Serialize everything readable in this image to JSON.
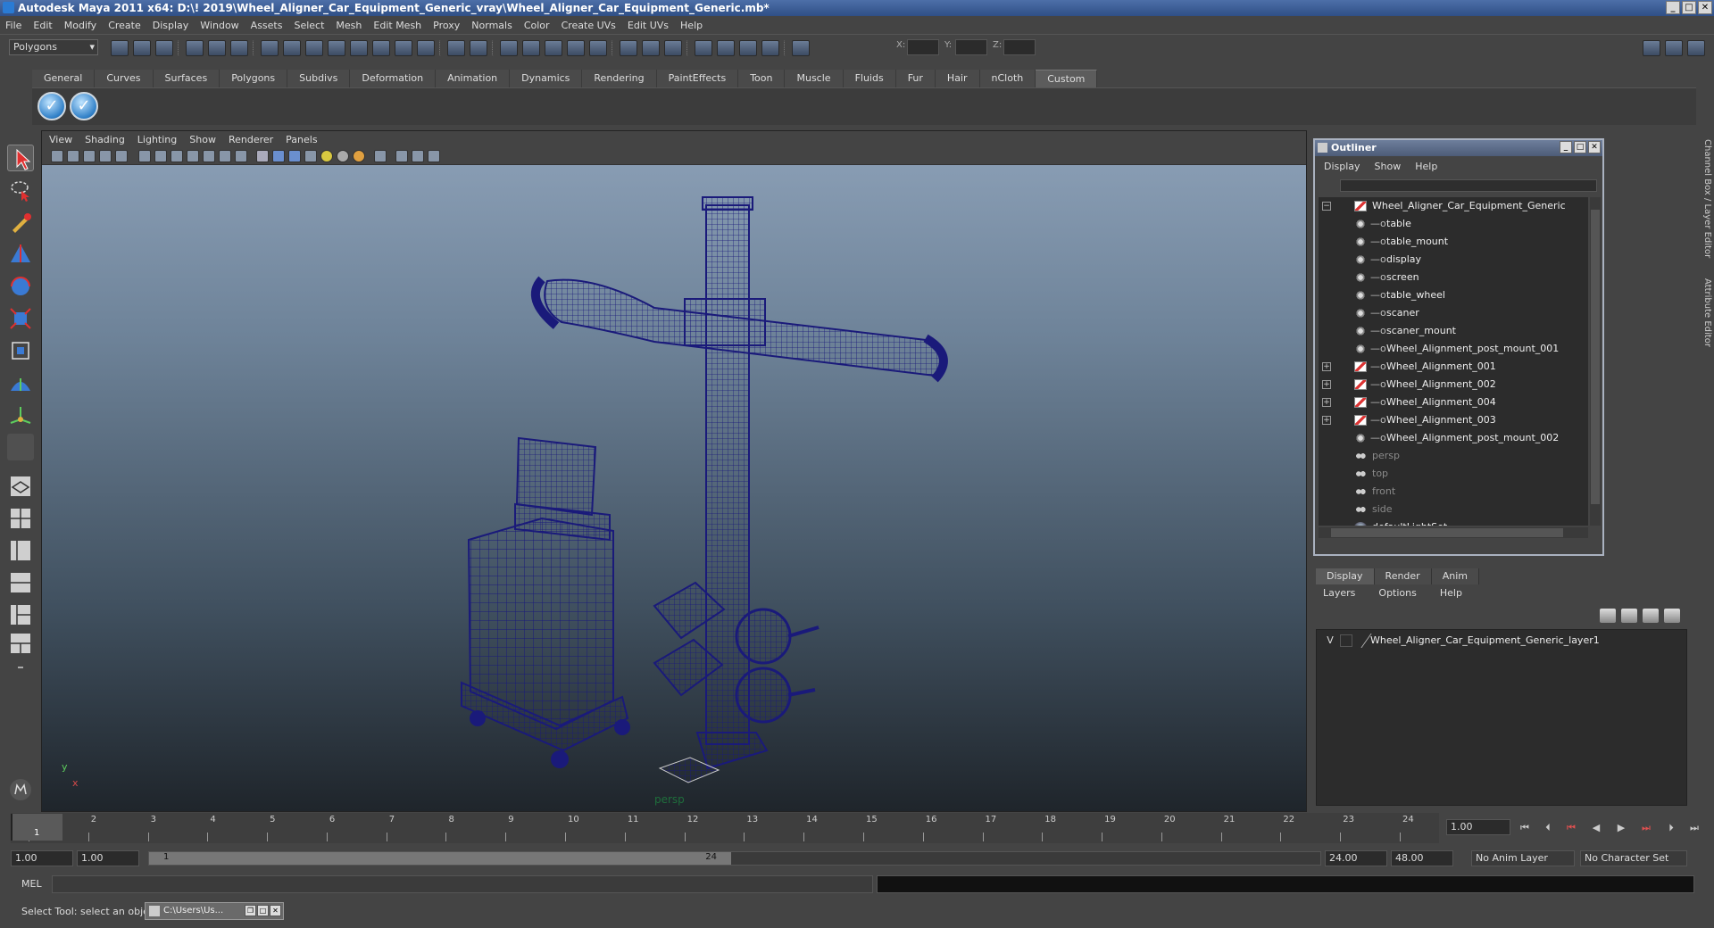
{
  "window": {
    "title": "Autodesk Maya 2011 x64: D:\\! 2019\\Wheel_Aligner_Car_Equipment_Generic_vray\\Wheel_Aligner_Car_Equipment_Generic.mb*"
  },
  "menubar": {
    "items": [
      "File",
      "Edit",
      "Modify",
      "Create",
      "Display",
      "Window",
      "Assets",
      "Select",
      "Mesh",
      "Edit Mesh",
      "Proxy",
      "Normals",
      "Color",
      "Create UVs",
      "Edit UVs",
      "Help"
    ]
  },
  "statusline": {
    "mode": "Polygons",
    "x_label": "X:",
    "y_label": "Y:",
    "z_label": "Z:"
  },
  "shelf": {
    "tabs": [
      "General",
      "Curves",
      "Surfaces",
      "Polygons",
      "Subdivs",
      "Deformation",
      "Animation",
      "Dynamics",
      "Rendering",
      "PaintEffects",
      "Toon",
      "Muscle",
      "Fluids",
      "Fur",
      "Hair",
      "nCloth",
      "Custom"
    ],
    "active_tab": "Custom"
  },
  "viewport": {
    "menu": [
      "View",
      "Shading",
      "Lighting",
      "Show",
      "Renderer",
      "Panels"
    ],
    "camera_label": "persp",
    "axis_y": "y",
    "axis_x": "x",
    "wire_color": "#1a1a7a"
  },
  "outliner": {
    "title": "Outliner",
    "menu": [
      "Display",
      "Show",
      "Help"
    ],
    "items": [
      {
        "label": "Wheel_Aligner_Car_Equipment_Generic",
        "icon": "group-icon",
        "expand": "−",
        "level": 0
      },
      {
        "label": "table",
        "icon": "mesh-icon",
        "level": 1
      },
      {
        "label": "table_mount",
        "icon": "mesh-icon",
        "level": 1
      },
      {
        "label": "display",
        "icon": "mesh-icon",
        "level": 1
      },
      {
        "label": "screen",
        "icon": "mesh-icon",
        "level": 1
      },
      {
        "label": "table_wheel",
        "icon": "mesh-icon",
        "level": 1
      },
      {
        "label": "scaner",
        "icon": "mesh-icon",
        "level": 1
      },
      {
        "label": "scaner_mount",
        "icon": "mesh-icon",
        "level": 1
      },
      {
        "label": "Wheel_Alignment_post_mount_001",
        "icon": "mesh-icon",
        "level": 1
      },
      {
        "label": "Wheel_Alignment_001",
        "icon": "group-icon",
        "expand": "+",
        "level": 1
      },
      {
        "label": "Wheel_Alignment_002",
        "icon": "group-icon",
        "expand": "+",
        "level": 1
      },
      {
        "label": "Wheel_Alignment_004",
        "icon": "group-icon",
        "expand": "+",
        "level": 1
      },
      {
        "label": "Wheel_Alignment_003",
        "icon": "group-icon",
        "expand": "+",
        "level": 1
      },
      {
        "label": "Wheel_Alignment_post_mount_002",
        "icon": "mesh-icon",
        "level": 1
      },
      {
        "label": "persp",
        "icon": "camera-icon",
        "level": 0,
        "dim": true
      },
      {
        "label": "top",
        "icon": "camera-icon",
        "level": 0,
        "dim": true
      },
      {
        "label": "front",
        "icon": "camera-icon",
        "level": 0,
        "dim": true
      },
      {
        "label": "side",
        "icon": "camera-icon",
        "level": 0,
        "dim": true
      },
      {
        "label": "defaultLightSet",
        "icon": "light-set-icon",
        "level": 0
      }
    ]
  },
  "layer_editor": {
    "tabs": [
      "Display",
      "Render",
      "Anim"
    ],
    "active_tab": "Display",
    "menu": [
      "Layers",
      "Options",
      "Help"
    ],
    "layer": {
      "visible": "V",
      "name": "Wheel_Aligner_Car_Equipment_Generic_layer1"
    }
  },
  "right_strip": {
    "tab1": "Channel Box / Layer Editor",
    "tab2": "Attribute Editor"
  },
  "timeline": {
    "ticks": [
      "1",
      "2",
      "3",
      "4",
      "5",
      "6",
      "7",
      "8",
      "9",
      "10",
      "11",
      "12",
      "13",
      "14",
      "15",
      "16",
      "17",
      "18",
      "19",
      "20",
      "21",
      "22",
      "23",
      "24"
    ],
    "current_frame": "1",
    "current_field": "1.00"
  },
  "range": {
    "start": "1.00",
    "playback_start": "1.00",
    "handle_start": "1",
    "handle_end": "24",
    "playback_end": "24.00",
    "end": "48.00",
    "anim_layer": "No Anim Layer",
    "character_set": "No Character Set"
  },
  "command": {
    "label": "MEL"
  },
  "help": {
    "text": "Select Tool: select an object",
    "task_button": "C:\\Users\\Us..."
  }
}
